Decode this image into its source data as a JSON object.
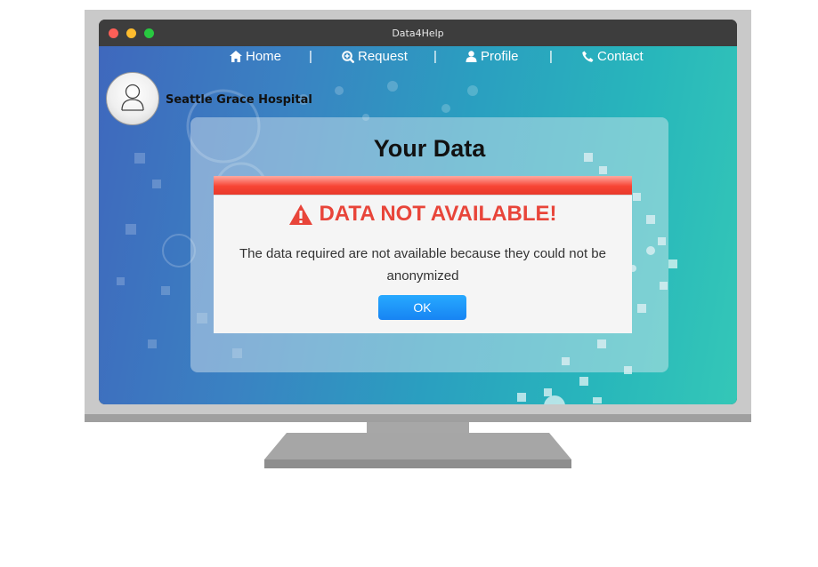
{
  "window": {
    "title": "Data4Help"
  },
  "nav": {
    "home": "Home",
    "request": "Request",
    "profile": "Profile",
    "contact": "Contact",
    "separator": "|"
  },
  "brand": {
    "hospital_name": "Seattle Grace Hospital"
  },
  "panel": {
    "title": "Your Data"
  },
  "dialog": {
    "title": "DATA NOT AVAILABLE!",
    "message": "The data required are not available because they could not be anonymized",
    "ok_label": "OK"
  },
  "icons": {
    "home": "home-icon",
    "request": "search-plus-icon",
    "profile": "user-icon",
    "contact": "phone-icon",
    "warning": "warning-icon",
    "avatar": "user-avatar-icon"
  },
  "colors": {
    "alert_red": "#e8453a",
    "button_blue": "#1784f3",
    "gradient_start": "#3f68bd",
    "gradient_end": "#34c7b7"
  }
}
